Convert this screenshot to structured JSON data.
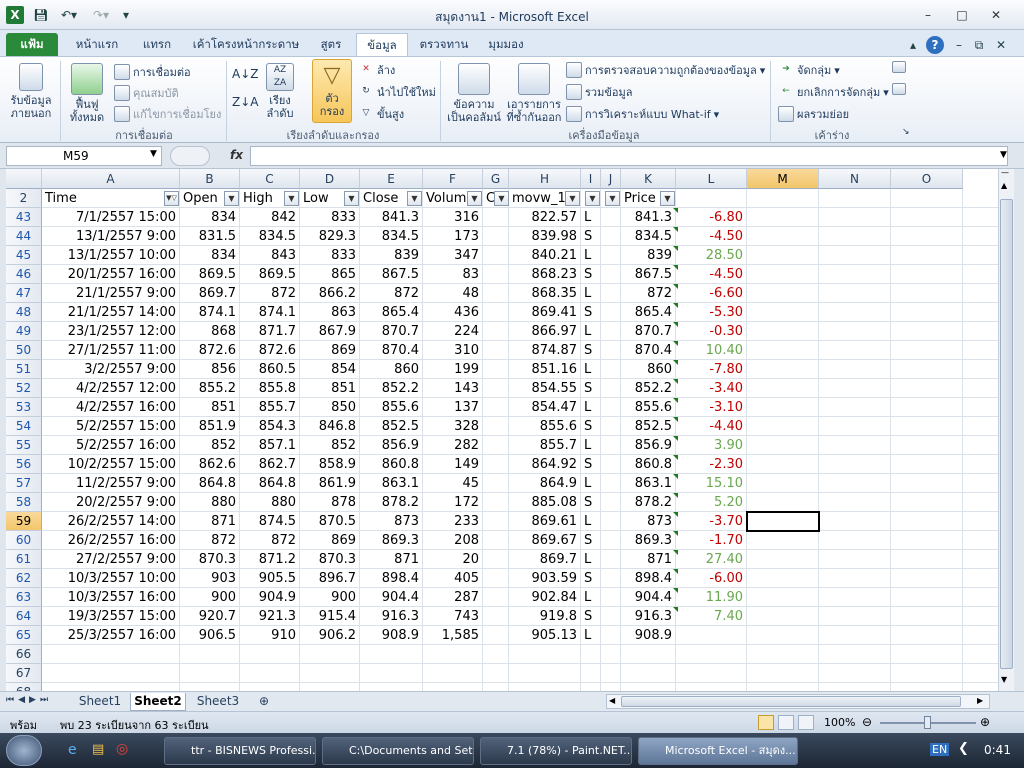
{
  "window": {
    "title": "สมุดงาน1 - Microsoft Excel"
  },
  "ribbon_tabs": [
    "แฟ้ม",
    "หน้าแรก",
    "แทรก",
    "เค้าโครงหน้ากระดาษ",
    "สูตร",
    "ข้อมูล",
    "ตรวจทาน",
    "มุมมอง"
  ],
  "ribbon": {
    "get_data": "รับข้อมูล\nภายนอก",
    "refresh_all": "ฟื้นฟู\nทั้งหมด",
    "connections": "การเชื่อมต่อ",
    "properties": "คุณสมบัติ",
    "edit_links": "แก้ไขการเชื่อมโยง",
    "group_connections": "การเชื่อมต่อ",
    "sort": "เรียงลำดับ",
    "filter": "ตัว\nกรอง",
    "clear": "ล้าง",
    "reapply": "นำไปใช้ใหม่",
    "advanced": "ขั้นสูง",
    "group_sort": "เรียงลำดับและกรอง",
    "text_to_columns": "ข้อความ\nเป็นคอลัมน์",
    "remove_duplicates": "เอารายการ\nที่ซ้ำกันออก",
    "data_validation": "การตรวจสอบความถูกต้องของข้อมูล",
    "consolidate": "รวมข้อมูล",
    "what_if": "การวิเคราะห์แบบ What-if",
    "group_tools": "เครื่องมือข้อมูล",
    "group": "จัดกลุ่ม",
    "ungroup": "ยกเลิกการจัดกลุ่ม",
    "subtotal": "ผลรวมย่อย",
    "group_outline": "เค้าร่าง"
  },
  "formula_bar": {
    "name_box": "M59",
    "fx": "fx",
    "formula": ""
  },
  "columns": [
    "A",
    "B",
    "C",
    "D",
    "E",
    "F",
    "G",
    "H",
    "I",
    "J",
    "K",
    "L",
    "M",
    "N",
    "O"
  ],
  "selected_column": "M",
  "header_row": {
    "row": "2",
    "cells": [
      "Time",
      "Open",
      "High",
      "Low",
      "Close",
      "Volum",
      "C",
      "movw_1",
      "",
      "",
      "Price",
      "",
      "",
      "",
      ""
    ]
  },
  "rows": [
    {
      "row": "43",
      "time": "7/1/2557 15:00",
      "open": "834",
      "high": "842",
      "low": "833",
      "close": "841.3",
      "volume": "316",
      "mov": "822.57",
      "side": "L",
      "price": "841.3",
      "diff": "-6.80"
    },
    {
      "row": "44",
      "time": "13/1/2557 9:00",
      "open": "831.5",
      "high": "834.5",
      "low": "829.3",
      "close": "834.5",
      "volume": "173",
      "mov": "839.98",
      "side": "S",
      "price": "834.5",
      "diff": "-4.50"
    },
    {
      "row": "45",
      "time": "13/1/2557 10:00",
      "open": "834",
      "high": "843",
      "low": "833",
      "close": "839",
      "volume": "347",
      "mov": "840.21",
      "side": "L",
      "price": "839",
      "diff": "28.50"
    },
    {
      "row": "46",
      "time": "20/1/2557 16:00",
      "open": "869.5",
      "high": "869.5",
      "low": "865",
      "close": "867.5",
      "volume": "83",
      "mov": "868.23",
      "side": "S",
      "price": "867.5",
      "diff": "-4.50"
    },
    {
      "row": "47",
      "time": "21/1/2557 9:00",
      "open": "869.7",
      "high": "872",
      "low": "866.2",
      "close": "872",
      "volume": "48",
      "mov": "868.35",
      "side": "L",
      "price": "872",
      "diff": "-6.60"
    },
    {
      "row": "48",
      "time": "21/1/2557 14:00",
      "open": "874.1",
      "high": "874.1",
      "low": "863",
      "close": "865.4",
      "volume": "436",
      "mov": "869.41",
      "side": "S",
      "price": "865.4",
      "diff": "-5.30"
    },
    {
      "row": "49",
      "time": "23/1/2557 12:00",
      "open": "868",
      "high": "871.7",
      "low": "867.9",
      "close": "870.7",
      "volume": "224",
      "mov": "866.97",
      "side": "L",
      "price": "870.7",
      "diff": "-0.30"
    },
    {
      "row": "50",
      "time": "27/1/2557 11:00",
      "open": "872.6",
      "high": "872.6",
      "low": "869",
      "close": "870.4",
      "volume": "310",
      "mov": "874.87",
      "side": "S",
      "price": "870.4",
      "diff": "10.40"
    },
    {
      "row": "51",
      "time": "3/2/2557 9:00",
      "open": "856",
      "high": "860.5",
      "low": "854",
      "close": "860",
      "volume": "199",
      "mov": "851.16",
      "side": "L",
      "price": "860",
      "diff": "-7.80"
    },
    {
      "row": "52",
      "time": "4/2/2557 12:00",
      "open": "855.2",
      "high": "855.8",
      "low": "851",
      "close": "852.2",
      "volume": "143",
      "mov": "854.55",
      "side": "S",
      "price": "852.2",
      "diff": "-3.40"
    },
    {
      "row": "53",
      "time": "4/2/2557 16:00",
      "open": "851",
      "high": "855.7",
      "low": "850",
      "close": "855.6",
      "volume": "137",
      "mov": "854.47",
      "side": "L",
      "price": "855.6",
      "diff": "-3.10"
    },
    {
      "row": "54",
      "time": "5/2/2557 15:00",
      "open": "851.9",
      "high": "854.3",
      "low": "846.8",
      "close": "852.5",
      "volume": "328",
      "mov": "855.6",
      "side": "S",
      "price": "852.5",
      "diff": "-4.40"
    },
    {
      "row": "55",
      "time": "5/2/2557 16:00",
      "open": "852",
      "high": "857.1",
      "low": "852",
      "close": "856.9",
      "volume": "282",
      "mov": "855.7",
      "side": "L",
      "price": "856.9",
      "diff": "3.90"
    },
    {
      "row": "56",
      "time": "10/2/2557 15:00",
      "open": "862.6",
      "high": "862.7",
      "low": "858.9",
      "close": "860.8",
      "volume": "149",
      "mov": "864.92",
      "side": "S",
      "price": "860.8",
      "diff": "-2.30"
    },
    {
      "row": "57",
      "time": "11/2/2557 9:00",
      "open": "864.8",
      "high": "864.8",
      "low": "861.9",
      "close": "863.1",
      "volume": "45",
      "mov": "864.9",
      "side": "L",
      "price": "863.1",
      "diff": "15.10"
    },
    {
      "row": "58",
      "time": "20/2/2557 9:00",
      "open": "880",
      "high": "880",
      "low": "878",
      "close": "878.2",
      "volume": "172",
      "mov": "885.08",
      "side": "S",
      "price": "878.2",
      "diff": "5.20"
    },
    {
      "row": "59",
      "time": "26/2/2557 14:00",
      "open": "871",
      "high": "874.5",
      "low": "870.5",
      "close": "873",
      "volume": "233",
      "mov": "869.61",
      "side": "L",
      "price": "873",
      "diff": "-3.70"
    },
    {
      "row": "60",
      "time": "26/2/2557 16:00",
      "open": "872",
      "high": "872",
      "low": "869",
      "close": "869.3",
      "volume": "208",
      "mov": "869.67",
      "side": "S",
      "price": "869.3",
      "diff": "-1.70"
    },
    {
      "row": "61",
      "time": "27/2/2557 9:00",
      "open": "870.3",
      "high": "871.2",
      "low": "870.3",
      "close": "871",
      "volume": "20",
      "mov": "869.7",
      "side": "L",
      "price": "871",
      "diff": "27.40"
    },
    {
      "row": "62",
      "time": "10/3/2557 10:00",
      "open": "903",
      "high": "905.5",
      "low": "896.7",
      "close": "898.4",
      "volume": "405",
      "mov": "903.59",
      "side": "S",
      "price": "898.4",
      "diff": "-6.00"
    },
    {
      "row": "63",
      "time": "10/3/2557 16:00",
      "open": "900",
      "high": "904.9",
      "low": "900",
      "close": "904.4",
      "volume": "287",
      "mov": "902.84",
      "side": "L",
      "price": "904.4",
      "diff": "11.90"
    },
    {
      "row": "64",
      "time": "19/3/2557 15:00",
      "open": "920.7",
      "high": "921.3",
      "low": "915.4",
      "close": "916.3",
      "volume": "743",
      "mov": "919.8",
      "side": "S",
      "price": "916.3",
      "diff": "7.40"
    },
    {
      "row": "65",
      "time": "25/3/2557 16:00",
      "open": "906.5",
      "high": "910",
      "low": "906.2",
      "close": "908.9",
      "volume": "1,585",
      "mov": "905.13",
      "side": "L",
      "price": "908.9",
      "diff": ""
    }
  ],
  "empty_rows": [
    "66",
    "67",
    "68"
  ],
  "selected_row": "59",
  "sheet_tabs": [
    "Sheet1",
    "Sheet2",
    "Sheet3"
  ],
  "active_sheet": "Sheet2",
  "status": {
    "ready": "พร้อม",
    "filter_info": "พบ 23 ระเบียนจาก 63 ระเบียน",
    "zoom": "100%"
  },
  "taskbar": {
    "tasks": [
      "ttr - BISNEWS Professi...",
      "C:\\Documents and Set...",
      "7.1 (78%) - Paint.NET...",
      "Microsoft Excel - สมุดง..."
    ],
    "lang": "EN",
    "clock": "0:41"
  },
  "colors": {
    "negative": "#c00000",
    "positive": "#6aa84f",
    "accent": "#2a8a3a"
  }
}
